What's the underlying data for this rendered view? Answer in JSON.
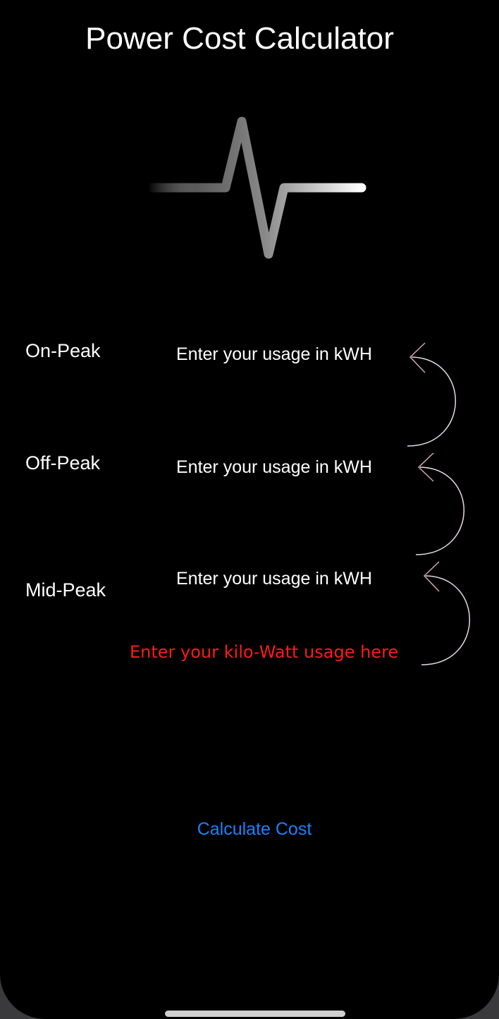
{
  "app": {
    "title": "Power Cost Calculator",
    "logo_icon": "pulse-waveform-icon"
  },
  "rows": [
    {
      "label": "On-Peak",
      "placeholder": "Enter your usage in kWH"
    },
    {
      "label": "Off-Peak",
      "placeholder": "Enter your usage in kWH"
    },
    {
      "label": "Mid-Peak",
      "placeholder": "Enter your usage in kWH"
    }
  ],
  "hint": {
    "text": "Enter your kilo-Watt usage here",
    "color": "#ff1a1a"
  },
  "actions": {
    "calculate_label": "Calculate Cost",
    "accent_color": "#1a82ff"
  }
}
